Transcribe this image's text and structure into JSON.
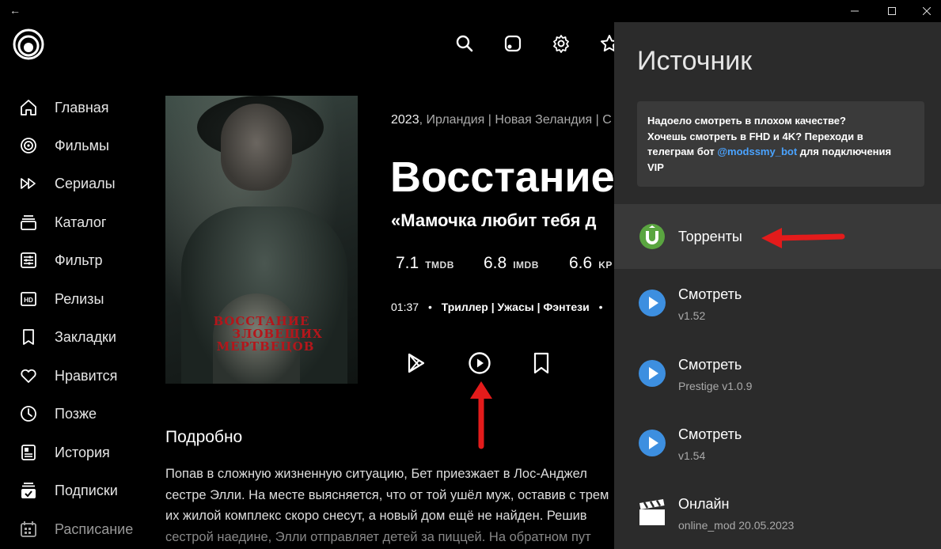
{
  "window": {
    "back_label": "←",
    "minimize": "—",
    "maximize": "☐",
    "close": "✕"
  },
  "sidebar": {
    "items": [
      {
        "label": "Главная",
        "icon": "home-icon"
      },
      {
        "label": "Фильмы",
        "icon": "film-reel-icon"
      },
      {
        "label": "Сериалы",
        "icon": "double-play-icon"
      },
      {
        "label": "Каталог",
        "icon": "catalog-icon"
      },
      {
        "label": "Фильтр",
        "icon": "filter-icon"
      },
      {
        "label": "Релизы",
        "icon": "hd-icon"
      },
      {
        "label": "Закладки",
        "icon": "bookmark-icon"
      },
      {
        "label": "Нравится",
        "icon": "heart-icon"
      },
      {
        "label": "Позже",
        "icon": "clock-icon"
      },
      {
        "label": "История",
        "icon": "history-icon"
      },
      {
        "label": "Подписки",
        "icon": "subscriptions-icon"
      },
      {
        "label": "Расписание",
        "icon": "calendar-icon"
      }
    ]
  },
  "movie": {
    "poster_title_line1": "ВОССТАНИЕ",
    "poster_title_line2": "ЗЛОВЕЩИХ",
    "poster_title_line3": "МЕРТВЕЦОВ",
    "year": "2023",
    "countries": ", Ирландия | Новая Зеландия | С",
    "title": "Восстание",
    "tagline": "«Мамочка любит тебя д",
    "ratings": [
      {
        "value": "7.1",
        "source": "TMDB"
      },
      {
        "value": "6.8",
        "source": "IMDB"
      },
      {
        "value": "6.6",
        "source": "KP"
      }
    ],
    "duration": "01:37",
    "genres": "Триллер | Ужасы | Фэнтези",
    "details_heading": "Подробно",
    "description_lines": [
      "Попав в сложную жизненную ситуацию, Бет приезжает в Лос-Анджел",
      "сестре Элли. На месте выясняется, что от той ушёл муж, оставив с трем",
      "их жилой комплекс скоро снесут, а новый дом ещё не найден. Решив",
      "сестрой наедине, Элли отправляет детей за пиццей. На обратном пут"
    ]
  },
  "panel": {
    "title": "Источник",
    "notice_line1": "Надоело смотреть в плохом качестве?",
    "notice_line2": "Хочешь смотреть в FHD и 4K? Переходи в",
    "notice_line3_pre": "телеграм бот ",
    "notice_link": "@modssmy_bot",
    "notice_line3_post": " для подключения",
    "notice_line4": "VIP",
    "sources": [
      {
        "name": "Торренты",
        "version": "",
        "icon": "utorrent-icon"
      },
      {
        "name": "Смотреть",
        "version": "v1.52",
        "icon": "play-circle-icon"
      },
      {
        "name": "Смотреть",
        "version": "Prestige v1.0.9",
        "icon": "play-circle-icon"
      },
      {
        "name": "Смотреть",
        "version": "v1.54",
        "icon": "play-circle-icon"
      },
      {
        "name": "Онлайн",
        "version": "online_mod 20.05.2023",
        "icon": "clapperboard-icon"
      }
    ]
  },
  "colors": {
    "accent_blue": "#4aa3ff",
    "utorrent_green": "#5aa540",
    "play_blue": "#3d8fe0",
    "annotation_red": "#e31b1b"
  }
}
